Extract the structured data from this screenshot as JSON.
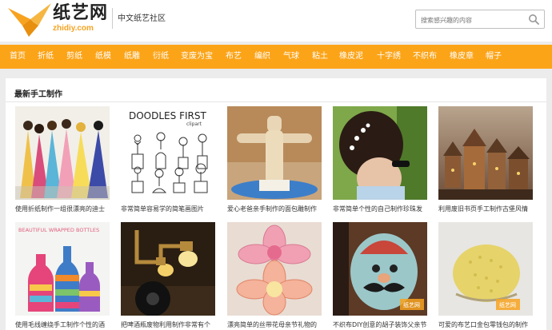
{
  "header": {
    "logo_cn": "纸艺网",
    "logo_en": "zhidiy.com",
    "tagline": "中文纸艺社区",
    "search_placeholder": "搜索感兴趣的内容"
  },
  "nav": {
    "items": [
      "首页",
      "折纸",
      "剪纸",
      "纸模",
      "纸雕",
      "衍纸",
      "变废为宝",
      "布艺",
      "编织",
      "气球",
      "粘土",
      "橡皮泥",
      "十字绣",
      "不织布",
      "橡皮章",
      "帽子"
    ]
  },
  "section": {
    "title": "最新手工制作",
    "cards": [
      {
        "caption": "使用折纸制作一组很漂亮的迪士"
      },
      {
        "caption": "非常简单容易学的简笔画图片"
      },
      {
        "caption": "爱心老爸亲手制作的面包雕制作"
      },
      {
        "caption": "非常简单个性的自己制作珍珠发"
      },
      {
        "caption": "利用废旧书页手工制作古堡风情"
      },
      {
        "caption": "使用毛线缠绕手工制作个性的酒"
      },
      {
        "caption": "把啤酒瓶废物利用制作非常有个"
      },
      {
        "caption": "漂亮简单的丝带花母亲节礼物的"
      },
      {
        "caption": "不织布DIY创意的胡子装饰父亲节礼"
      },
      {
        "caption": "可爱的布艺口金包零钱包的制作"
      }
    ],
    "image_texts": {
      "doodles_title": "DOODLES FIRST",
      "doodles_sub": "clipart",
      "bottles_text": "BEAUTIFUL WRAPPED BOTTLES",
      "watermark": "纸艺网"
    }
  },
  "colors": {
    "accent": "#fca418",
    "logo_orange": "#f7a320",
    "nav_text": "#ffffff"
  }
}
